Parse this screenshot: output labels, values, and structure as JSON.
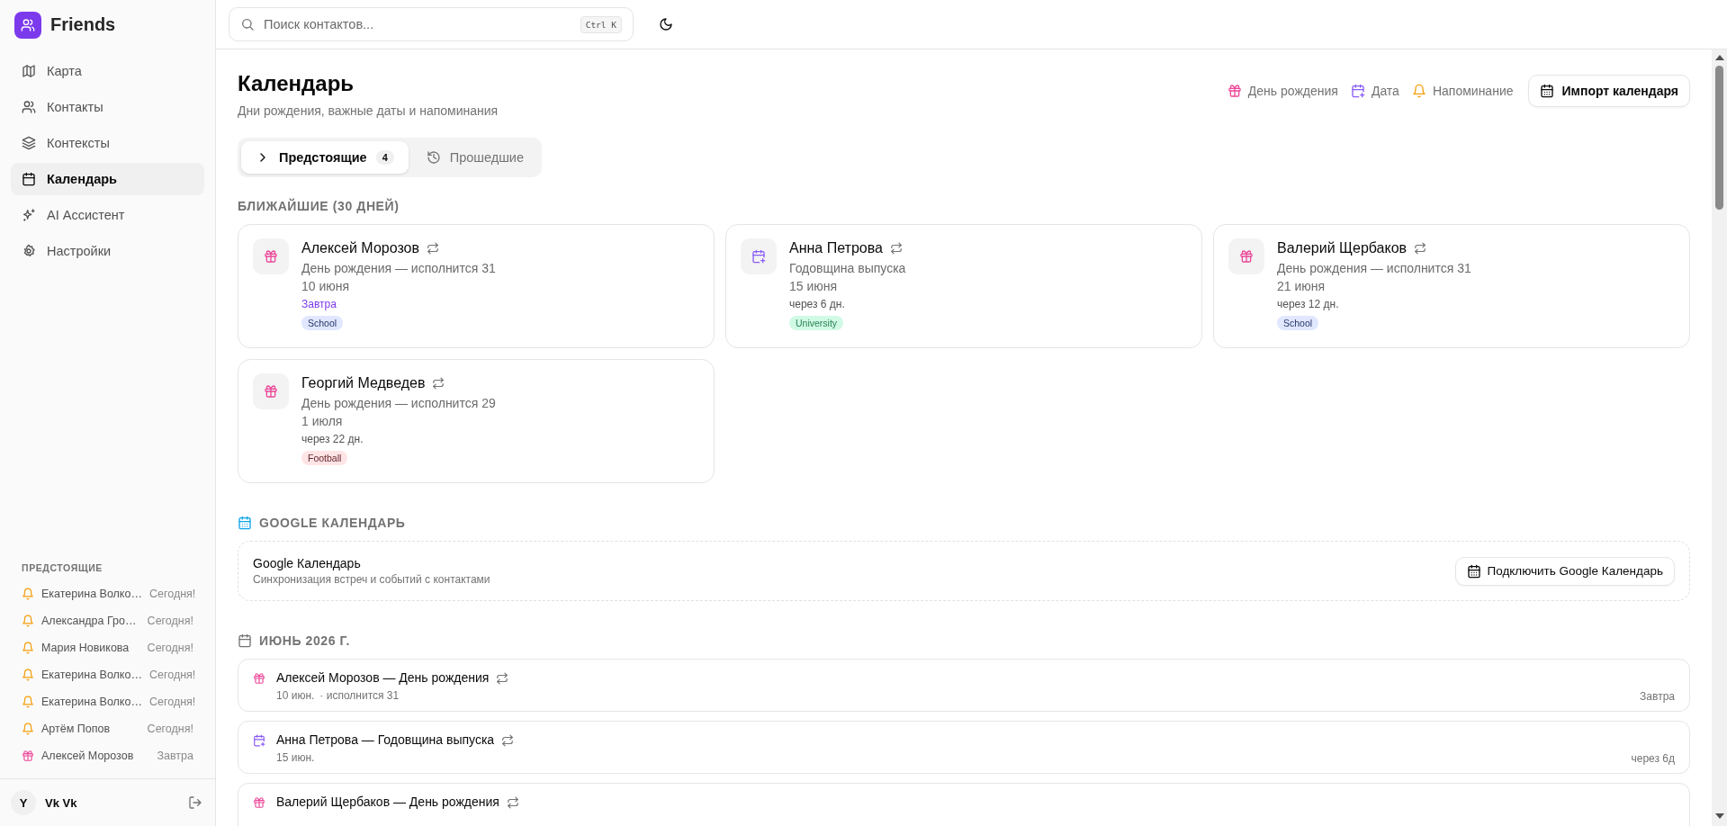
{
  "app": {
    "name": "Friends"
  },
  "nav": [
    {
      "label": "Карта",
      "selected": false
    },
    {
      "label": "Контакты",
      "selected": false
    },
    {
      "label": "Контексты",
      "selected": false
    },
    {
      "label": "Календарь",
      "selected": true
    },
    {
      "label": "AI Ассистент",
      "selected": false
    },
    {
      "label": "Настройки",
      "selected": false
    }
  ],
  "upcoming": {
    "title": "ПРЕДСТОЯЩИЕ",
    "items": [
      {
        "kind": "reminder",
        "name": "Екатерина Волко…",
        "when": "Сегодня!"
      },
      {
        "kind": "reminder",
        "name": "Александра Гро…",
        "when": "Сегодня!"
      },
      {
        "kind": "reminder",
        "name": "Мария Новикова",
        "when": "Сегодня!"
      },
      {
        "kind": "reminder",
        "name": "Екатерина Волко…",
        "when": "Сегодня!"
      },
      {
        "kind": "reminder",
        "name": "Екатерина Волко…",
        "when": "Сегодня!"
      },
      {
        "kind": "reminder",
        "name": "Артём Попов",
        "when": "Сегодня!"
      },
      {
        "kind": "birthday",
        "name": "Алексей Морозов",
        "when": "Завтра"
      }
    ]
  },
  "user": {
    "initial": "Y",
    "name": "Vk Vk"
  },
  "search": {
    "placeholder": "Поиск контактов...",
    "shortcut": "Ctrl K"
  },
  "page": {
    "title": "Календарь",
    "subtitle": "Дни рождения, важные даты и напоминания"
  },
  "legend": [
    {
      "kind": "birthday",
      "label": "День рождения"
    },
    {
      "kind": "date",
      "label": "Дата"
    },
    {
      "kind": "reminder",
      "label": "Напоминание"
    }
  ],
  "import_button": "Импорт календаря",
  "tabs": [
    {
      "label": "Предстоящие",
      "count": "4",
      "selected": true
    },
    {
      "label": "Прошедшие",
      "selected": false
    }
  ],
  "nearest": {
    "title": "БЛИЖАЙШИЕ (30 ДНЕЙ)",
    "cards": [
      {
        "kind": "birthday",
        "name": "Алексей Морозов",
        "recurring": true,
        "desc": "День рождения — исполнится 31",
        "date": "10 июня",
        "when": "Завтра",
        "soon": true,
        "tag": {
          "label": "School",
          "color": "#e0e7ff"
        }
      },
      {
        "kind": "date",
        "name": "Анна Петрова",
        "recurring": true,
        "desc": "Годовщина выпуска",
        "date": "15 июня",
        "when": "через 6 дн.",
        "soon": false,
        "tag": {
          "label": "University",
          "color": "#d1fae5"
        }
      },
      {
        "kind": "birthday",
        "name": "Валерий Щербаков",
        "recurring": true,
        "desc": "День рождения — исполнится 31",
        "date": "21 июня",
        "when": "через 12 дн.",
        "soon": false,
        "tag": {
          "label": "School",
          "color": "#e0e7ff"
        }
      },
      {
        "kind": "birthday",
        "name": "Георгий Медведев",
        "recurring": true,
        "desc": "День рождения — исполнится 29",
        "date": "1 июля",
        "when": "через 22 дн.",
        "soon": false,
        "tag": {
          "label": "Football",
          "color": "#ffe4e6"
        }
      }
    ]
  },
  "google": {
    "title": "GOOGLE КАЛЕНДАРЬ",
    "name": "Google Календарь",
    "desc": "Синхронизация встреч и событий с контактами",
    "button": "Подключить Google Календарь"
  },
  "month": {
    "title": "ИЮНЬ 2026 Г.",
    "events": [
      {
        "kind": "birthday",
        "title": "Алексей Морозов — День рождения",
        "recurring": true,
        "date": "10 июн.",
        "note": "· исполнится 31",
        "when": "Завтра"
      },
      {
        "kind": "date",
        "title": "Анна Петрова — Годовщина выпуска",
        "recurring": true,
        "date": "15 июн.",
        "when": "через 6д"
      },
      {
        "kind": "birthday",
        "title": "Валерий Щербаков — День рождения",
        "recurring": true
      }
    ]
  }
}
